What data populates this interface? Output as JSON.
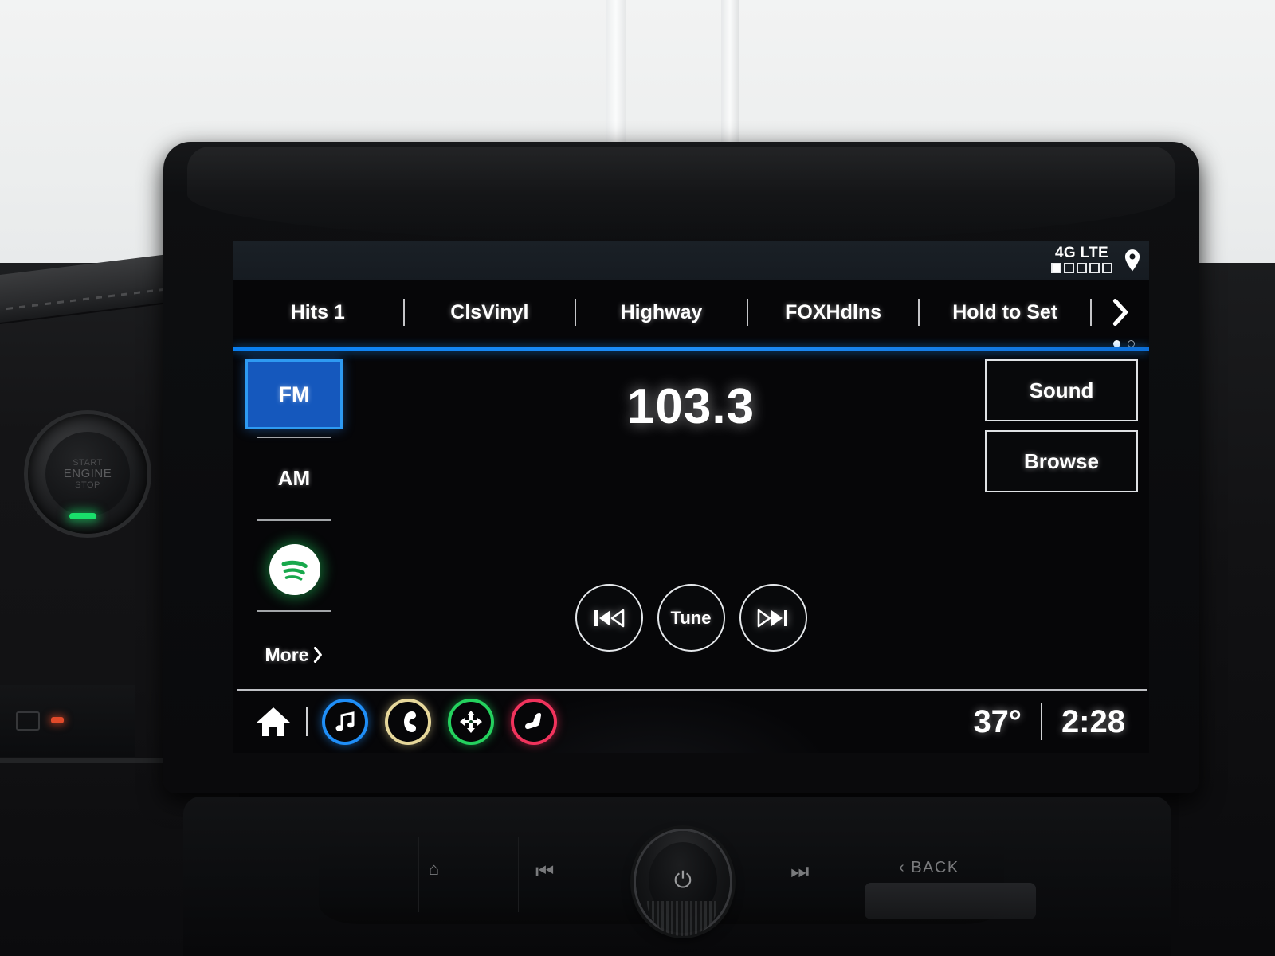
{
  "status_bar": {
    "network_label": "4G LTE",
    "signal_bars_total": 5,
    "signal_bars_filled": 1,
    "location_icon": "location-pin-icon"
  },
  "presets": {
    "items": [
      {
        "label": "Hits 1"
      },
      {
        "label": "ClsVinyl"
      },
      {
        "label": "Highway"
      },
      {
        "label": "FOXHdlns"
      },
      {
        "label": "Hold to Set"
      }
    ],
    "next_icon": "chevron-right-icon",
    "page_dots": {
      "total": 2,
      "active_index": 0
    }
  },
  "source_rail": {
    "fm_label": "FM",
    "am_label": "AM",
    "spotify_icon": "spotify-icon",
    "more_label": "More",
    "more_chevron": "chevron-right-icon"
  },
  "now_playing": {
    "frequency": "103.3",
    "band": "FM"
  },
  "right_buttons": {
    "sound_label": "Sound",
    "browse_label": "Browse"
  },
  "transport": {
    "prev_icon": "skip-previous-icon",
    "tune_label": "Tune",
    "next_icon": "skip-next-icon"
  },
  "bottom_bar": {
    "home_icon": "home-icon",
    "shortcuts": [
      {
        "name": "music-icon",
        "color": "#1f8ef7"
      },
      {
        "name": "phone-icon",
        "color": "#e6d79a"
      },
      {
        "name": "navigation-icon",
        "color": "#24d15e"
      },
      {
        "name": "seat-heater-icon",
        "color": "#f0335c"
      }
    ],
    "temperature": "37°",
    "time": "2:28"
  },
  "hardware": {
    "start_button": {
      "line1": "START",
      "line2": "ENGINE",
      "line3": "STOP"
    },
    "buttons": [
      {
        "name": "home-hard-button",
        "label": "⌂"
      },
      {
        "name": "previous-hard-button",
        "label": "⏮"
      },
      {
        "name": "power-volume-knob",
        "label": "⏻"
      },
      {
        "name": "next-hard-button",
        "label": "⏭"
      },
      {
        "name": "back-hard-button",
        "label": "‹ BACK"
      }
    ]
  },
  "colors": {
    "accent_blue": "#1f8ef7",
    "fm_fill": "#1558bd",
    "fm_border": "#2e9af2",
    "screen_bg": "#060608",
    "status_bg": "#1a2026"
  }
}
